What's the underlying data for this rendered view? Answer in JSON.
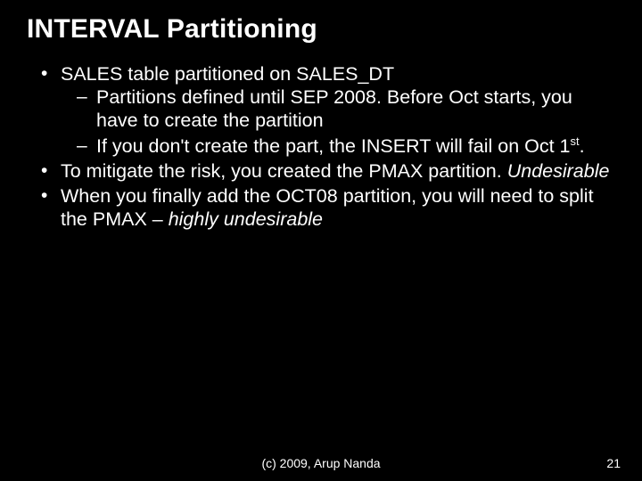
{
  "title": "INTERVAL Partitioning",
  "bullets": {
    "b1": "SALES table partitioned on SALES_DT",
    "b1a": "Partitions defined until SEP 2008. Before Oct starts, you have to create the partition",
    "b1b_pre": "If you don't create the part, the INSERT will fail on Oct 1",
    "b1b_sup": "st",
    "b1b_post": ".",
    "b2_pre": "To mitigate the risk, you created the PMAX partition. ",
    "b2_em": "Undesirable",
    "b3_pre": "When you finally add the OCT08 partition, you will need to split the PMAX – ",
    "b3_em": "highly undesirable"
  },
  "footer": {
    "copyright": "(c) 2009, Arup Nanda",
    "page": "21"
  }
}
